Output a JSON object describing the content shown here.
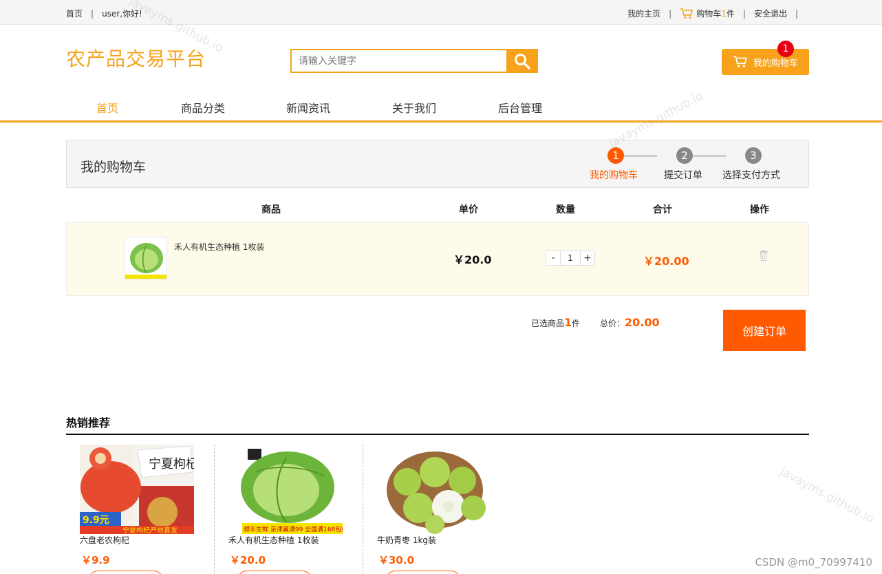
{
  "topbar": {
    "home": "首页",
    "greeting": "user,你好!",
    "my_home": "我的主页",
    "cart_prefix": "购物车",
    "cart_count": "1",
    "cart_suffix": "件",
    "logout": "安全退出"
  },
  "header": {
    "logo": "农产品交易平台",
    "search_placeholder": "请输入关键字",
    "my_cart": "我的购物车",
    "cart_badge": "1"
  },
  "nav": {
    "items": [
      "首页",
      "商品分类",
      "新闻资讯",
      "关于我们",
      "后台管理"
    ],
    "active": "首页"
  },
  "cart": {
    "title": "我的购物车",
    "steps": [
      {
        "num": "1",
        "label": "我的购物车"
      },
      {
        "num": "2",
        "label": "提交订单"
      },
      {
        "num": "3",
        "label": "选择支付方式"
      }
    ],
    "columns": [
      "商品",
      "单价",
      "数量",
      "合计",
      "操作"
    ],
    "item": {
      "name": "禾人有机生态种植 1枚装",
      "unit_price": "￥20.0",
      "qty_minus": "-",
      "qty": "1",
      "qty_plus": "+",
      "subtotal": "￥20.00"
    },
    "summary": {
      "selected_prefix": "已选商品",
      "selected_count": "1",
      "selected_suffix": "件",
      "total_label": "总价：",
      "total_value": "20.00"
    },
    "create_order": "创建订单"
  },
  "hot": {
    "title": "热销推荐",
    "products": [
      {
        "name": "六盘老农枸杞",
        "price": "￥9.9",
        "banner": "9.9元",
        "tag": "宁夏枸杞产地直发"
      },
      {
        "name": "禾人有机生态种植 1枚装",
        "price": "￥20.0",
        "banner": "顺丰生鲜 京津冀满99 全国满168包邮"
      },
      {
        "name": "牛奶青枣 1kg装",
        "price": "￥30.0"
      }
    ]
  },
  "watermark": "javayms.github.io",
  "footer_mark": "CSDN @m0_70997410",
  "colors": {
    "brand": "#f7a21a",
    "accent": "#ff5a00",
    "badge": "#e60012"
  }
}
